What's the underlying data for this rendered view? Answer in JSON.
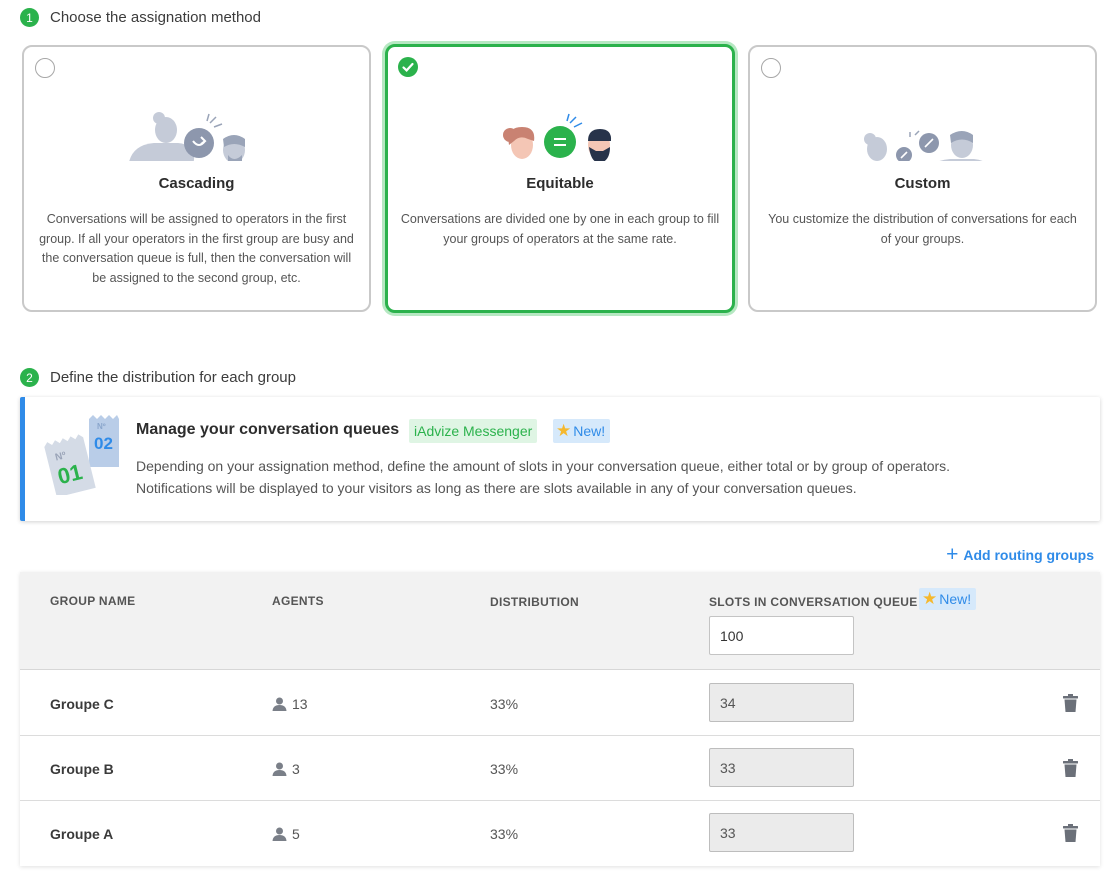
{
  "step1": {
    "number": "1",
    "title": "Choose the assignation method"
  },
  "methods": [
    {
      "title": "Cascading",
      "description": "Conversations will be assigned to operators in the first group. If all your operators in the first group are busy and the conversation queue is full, then the conversation will be assigned to the second group, etc.",
      "selected": false
    },
    {
      "title": "Equitable",
      "description": "Conversations are divided one by one in each group to fill your groups of operators at the same rate.",
      "selected": true
    },
    {
      "title": "Custom",
      "description": "You customize the distribution of conversations for each of your groups.",
      "selected": false
    }
  ],
  "step2": {
    "number": "2",
    "title": "Define the distribution for each group"
  },
  "info": {
    "title": "Manage your conversation queues",
    "tag_product": "iAdvize Messenger",
    "tag_new": "New!",
    "description_line1": "Depending on your assignation method, define the amount of slots in your conversation queue, either total or by group of operators.",
    "description_line2": "Notifications will be displayed to your visitors as long as there are slots available in any of your conversation queues.",
    "icon_ticket1": "Nº 01",
    "icon_ticket2": "Nº 02"
  },
  "add_routing_label": "Add routing groups",
  "table": {
    "headers": {
      "group_name": "GROUP NAME",
      "agents": "AGENTS",
      "distribution": "DISTRIBUTION",
      "slots": "SLOTS IN CONVERSATION QUEUE",
      "slots_tag": "New!"
    },
    "total_slots": "100",
    "rows": [
      {
        "name": "Groupe C",
        "agents": "13",
        "distribution": "33%",
        "slots": "34"
      },
      {
        "name": "Groupe B",
        "agents": "3",
        "distribution": "33%",
        "slots": "33"
      },
      {
        "name": "Groupe A",
        "agents": "5",
        "distribution": "33%",
        "slots": "33"
      }
    ]
  },
  "colors": {
    "green": "#2bb24c",
    "blue": "#2f8be8",
    "tag_green_bg": "#dff5e4",
    "tag_blue_bg": "#d6e9fb"
  }
}
